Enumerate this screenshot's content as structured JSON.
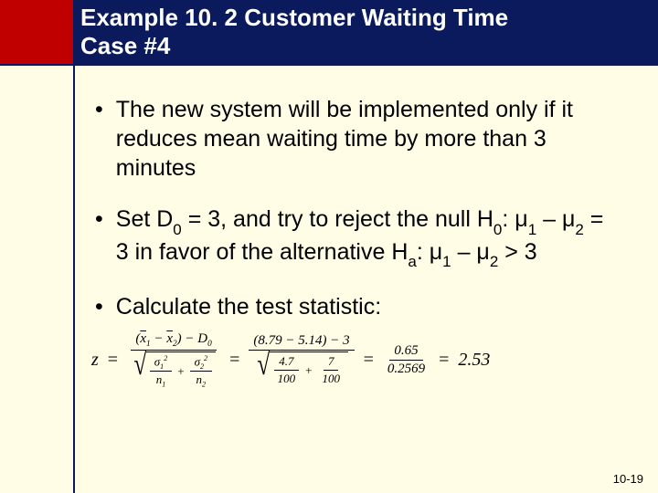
{
  "header": {
    "title_line1": "Example 10. 2 Customer Waiting Time",
    "title_line2": "Case #4"
  },
  "bullets": {
    "b1": "The new system will be implemented only if it reduces mean waiting time by more than 3 minutes",
    "b2_pre": "Set D",
    "b2_sub0": "0",
    "b2_mid1": " = 3, and try to reject the null H",
    "b2_subH0": "0",
    "b2_mid2": ": μ",
    "b2_subm1a": "1",
    "b2_mid3": " – μ",
    "b2_subm2a": "2",
    "b2_mid4": " = 3 in favor of the alternative H",
    "b2_subHa": "a",
    "b2_mid5": ": μ",
    "b2_subm1b": "1",
    "b2_mid6": " – μ",
    "b2_subm2b": "2",
    "b2_end": " > 3",
    "b3": "Calculate the test statistic:"
  },
  "equation": {
    "z": "z",
    "eq": "=",
    "num1_xbar1": "x",
    "num1_s1": "1",
    "num1_minus": " − ",
    "num1_xbar2": "x",
    "num1_s2": "2",
    "num1_close_minus": ") − D",
    "num1_D0sub": "0",
    "den1_sig": "σ",
    "den1_s1": "1",
    "den1_sq": "2",
    "den1_over_n1": "n",
    "den1_n1s": "1",
    "den1_plus": "+",
    "den1_s2": "2",
    "den1_n2s": "2",
    "num2": "(8.79 − 5.14) − 3",
    "den2_a": "4.7",
    "den2_b": "100",
    "den2_c": "7",
    "num3": "0.65",
    "den3": "0.2569",
    "result": "2.53"
  },
  "page_number": "10-19"
}
